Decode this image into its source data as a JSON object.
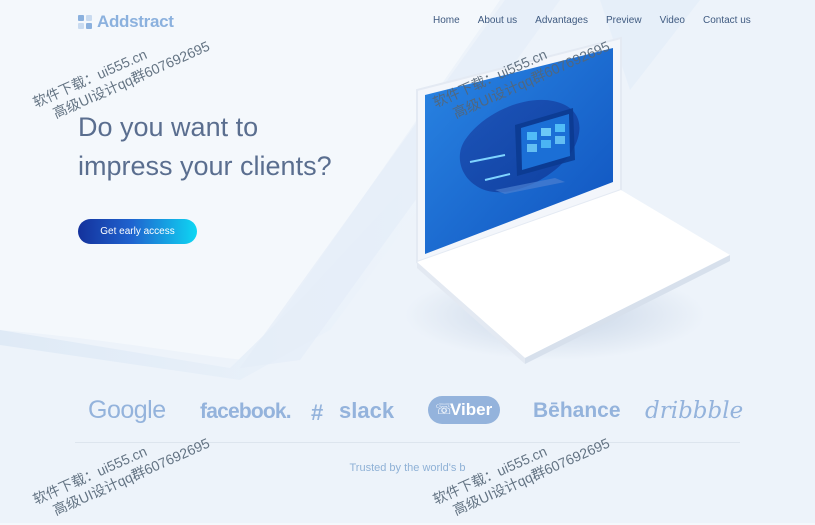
{
  "logo": {
    "text": "Addstract"
  },
  "nav": [
    "Home",
    "About us",
    "Advantages",
    "Preview",
    "Video",
    "Contact us"
  ],
  "hero": {
    "line1": "Do you want to",
    "line2": "impress your clients?",
    "cta_label": "Get early access"
  },
  "brands": [
    "Google",
    "facebook.",
    "slack",
    "Viber",
    "Bēhance",
    "dribbble"
  ],
  "trusted_text": "Trusted by the world's b",
  "watermark": {
    "line1": "软件下载：ui555.cn",
    "line2": "高级UI设计qq群607692695"
  },
  "colors": {
    "accent": "#1f63cf",
    "brand_logos": "#94b3dc",
    "logo_text": "#8bb1de",
    "screen_blue": "#1f6fd4"
  }
}
